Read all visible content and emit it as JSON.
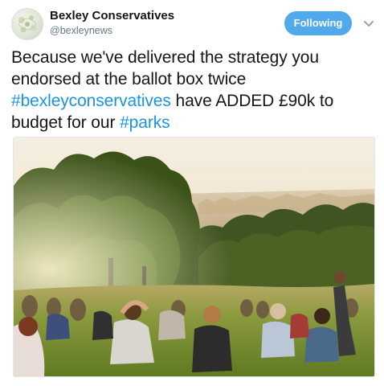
{
  "tweet": {
    "author": {
      "display_name": "Bexley Conservatives",
      "handle": "@bexleynews",
      "avatar_icon": "floral-logo-avatar"
    },
    "follow_button_label": "Following",
    "more_menu_icon": "chevron-down-icon",
    "text": {
      "line1": "Because we've delivered the strategy you",
      "line2": "endorsed at the ballot box twice",
      "hashtag1": "#bexleyconservatives",
      "line3_rest": " have ADDED £90k to",
      "line4_prefix": "budget for our ",
      "hashtag2": "#parks"
    },
    "media": {
      "type": "photo",
      "subject": "people-sitting-on-grass-in-park-at-sunset"
    }
  },
  "colors": {
    "accent": "#1b95e0",
    "follow_button": "#4fa9ea",
    "text": "#14171a",
    "secondary_text": "#657786"
  }
}
